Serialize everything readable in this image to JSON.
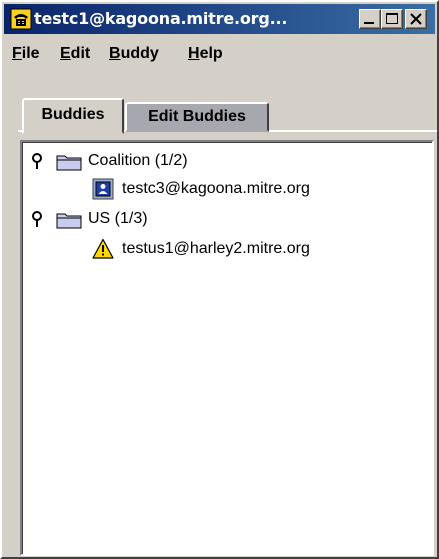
{
  "window": {
    "title": "testc1@kagoona.mitre.org...",
    "icon": "phone-icon"
  },
  "menu": {
    "items": [
      {
        "mnemonic": "F",
        "rest": "ile"
      },
      {
        "mnemonic": "E",
        "rest": "dit"
      },
      {
        "mnemonic": "B",
        "rest": "uddy"
      },
      {
        "mnemonic": "H",
        "rest": "elp"
      }
    ]
  },
  "tabs": [
    {
      "label": "Buddies",
      "active": true
    },
    {
      "label": "Edit Buddies",
      "active": false
    }
  ],
  "tree": {
    "groups": [
      {
        "label": "Coalition (1/2)",
        "buddies": [
          {
            "label": "testc3@kagoona.mitre.org",
            "status_icon": "user-online-icon"
          }
        ]
      },
      {
        "label": "US (1/3)",
        "buddies": [
          {
            "label": "testus1@harley2.mitre.org",
            "status_icon": "warning-icon"
          }
        ]
      }
    ]
  },
  "colors": {
    "titlebar_start": "#0a246a",
    "titlebar_end": "#3a6ea5",
    "chrome": "#d4d0c8",
    "inactive_tab": "#a7a7b0"
  }
}
